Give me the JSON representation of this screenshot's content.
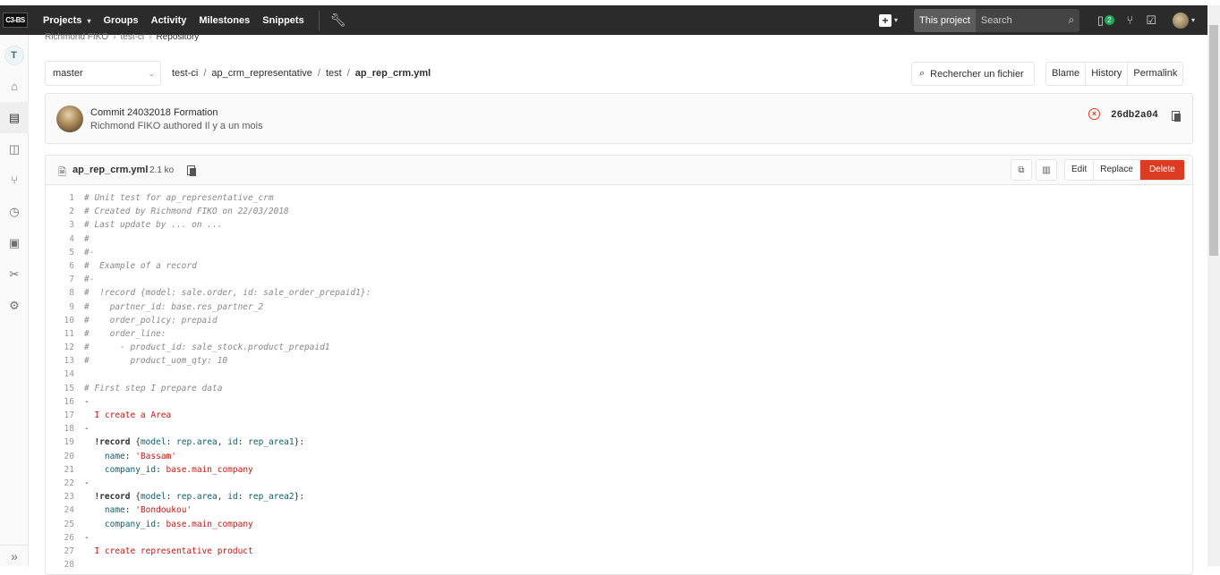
{
  "navbar": {
    "logo": "C3-BS",
    "links": [
      "Projects",
      "Groups",
      "Activity",
      "Milestones",
      "Snippets"
    ],
    "search_scope": "This project",
    "search_placeholder": "Search",
    "issues_badge": "2"
  },
  "sidebar": {
    "avatar_letter": "T",
    "items": [
      "home-icon",
      "repository-icon",
      "issues-icon",
      "merge-requests-icon",
      "pipelines-icon",
      "wiki-icon",
      "snippets-icon",
      "settings-icon"
    ],
    "collapse_icon": "»"
  },
  "breadcrumb": [
    "Richmond FIKO",
    "test-ci",
    "Repository"
  ],
  "branch": "master",
  "path": [
    "test-ci",
    "ap_crm_representative",
    "test",
    "ap_rep_crm.yml"
  ],
  "find_file_label": "Rechercher un fichier",
  "view_buttons": [
    "Blame",
    "History",
    "Permalink"
  ],
  "commit": {
    "title": "Commit 24032018 Formation",
    "author_line": "Richmond FIKO authored Il y a un mois",
    "sha": "26db2a04",
    "status": "failed"
  },
  "file": {
    "name": "ap_rep_crm.yml",
    "size": "2.1 ko",
    "edit_buttons": [
      "Edit",
      "Replace",
      "Delete"
    ]
  },
  "code_lines": [
    "# Unit test for ap_representative_crm",
    "# Created by Richmond FIKO on 22/03/2018",
    "# Last update by ... on ...",
    "#",
    "#-",
    "#  Example of a record",
    "#-",
    "#  !record {model: sale.order, id: sale_order_prepaid1}:",
    "#    partner_id: base.res_partner_2",
    "#    order_policy: prepaid",
    "#    order_line:",
    "#      - product_id: sale_stock.product_prepaid1",
    "#        product_uom_qty: 10",
    "",
    "# First step I prepare data",
    "-",
    "  I create a Area",
    "-",
    "  !record {model: rep.area, id: rep_area1}:",
    "    name: 'Bassam'",
    "    company_id: base.main_company",
    "-",
    "  !record {model: rep.area, id: rep_area2}:",
    "    name: 'Bondoukou'",
    "    company_id: base.main_company",
    "-",
    "  I create representative product",
    ""
  ]
}
